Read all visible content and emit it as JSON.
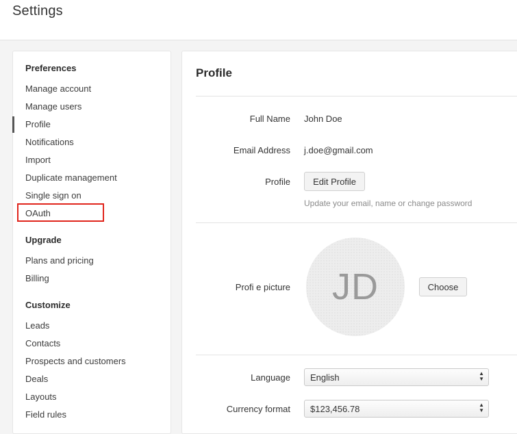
{
  "header": {
    "title": "Settings"
  },
  "sidebar": {
    "sections": [
      {
        "heading": "Preferences",
        "items": [
          "Manage account",
          "Manage users",
          "Profile",
          "Notifications",
          "Import",
          "Duplicate management",
          "Single sign on",
          "OAuth"
        ]
      },
      {
        "heading": "Upgrade",
        "items": [
          "Plans and pricing",
          "Billing"
        ]
      },
      {
        "heading": "Customize",
        "items": [
          "Leads",
          "Contacts",
          "Prospects and customers",
          "Deals",
          "Layouts",
          "Field rules"
        ]
      }
    ],
    "active_item": "Profile",
    "highlighted_item": "OAuth"
  },
  "profile": {
    "title": "Profile",
    "full_name_label": "Full Name",
    "full_name": "John Doe",
    "email_label": "Email Address",
    "email": "j.doe@gmail.com",
    "profile_label": "Profile",
    "edit_profile_button": "Edit Profile",
    "edit_hint": "Update your email, name or change password",
    "picture_label": "Profi e picture",
    "avatar_initials": "JD",
    "choose_button": "Choose",
    "language_label": "Language",
    "language_value": "English",
    "currency_label": "Currency format",
    "currency_value": "$123,456.78"
  },
  "colors": {
    "highlight_border": "#e0241b",
    "active_indicator": "#555555"
  },
  "icons": {
    "select_arrows": "updown-chevron-icon"
  }
}
